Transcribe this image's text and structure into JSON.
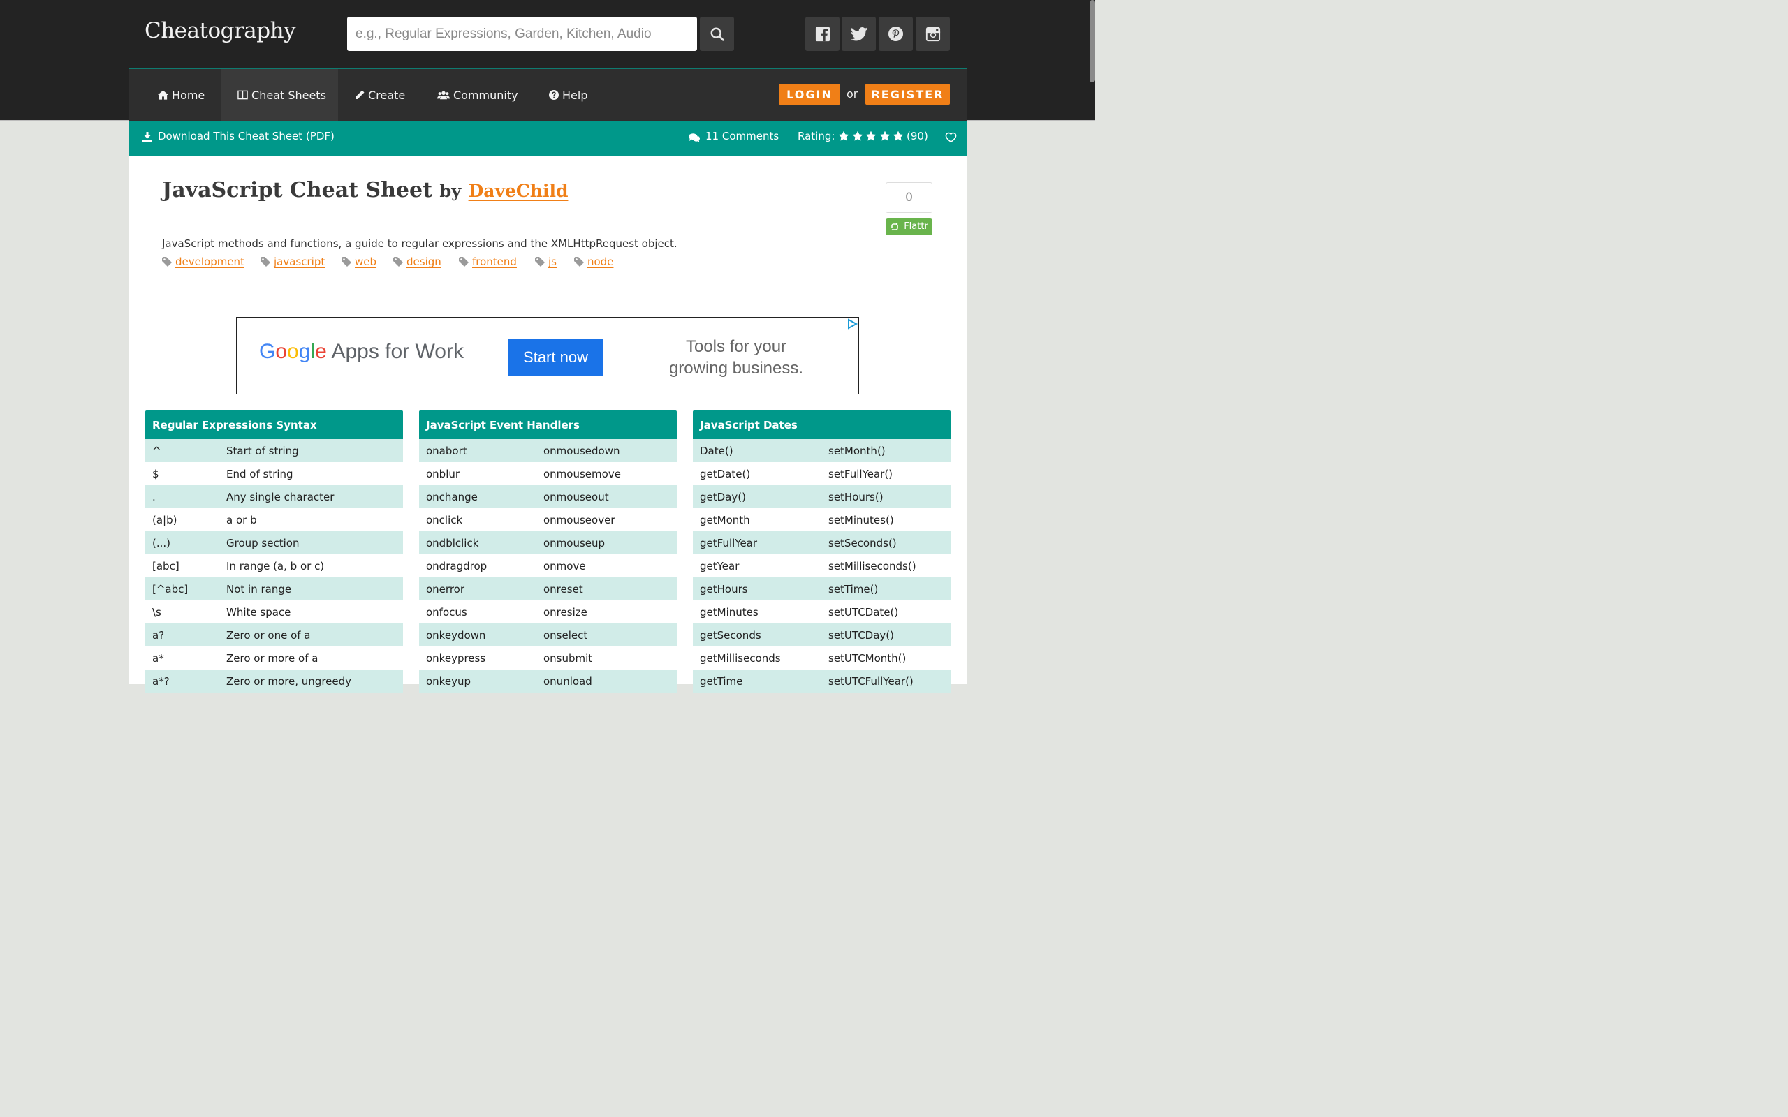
{
  "header": {
    "logo": "Cheatography",
    "search_placeholder": "e.g., Regular Expressions, Garden, Kitchen, Audio"
  },
  "nav": {
    "items": [
      {
        "label": "Home",
        "icon": "home-icon"
      },
      {
        "label": "Cheat Sheets",
        "icon": "book-icon"
      },
      {
        "label": "Create",
        "icon": "pencil-icon"
      },
      {
        "label": "Community",
        "icon": "users-icon"
      },
      {
        "label": "Help",
        "icon": "question-circle-icon"
      }
    ],
    "login": "LOGIN",
    "or": "or",
    "register": "REGISTER"
  },
  "toolbar": {
    "download": "Download This Cheat Sheet (PDF)",
    "comments": "11 Comments",
    "rating_label": "Rating:",
    "stars": 5,
    "rating_count": "(90)"
  },
  "sheet": {
    "title": "JavaScript Cheat Sheet",
    "by": "by",
    "author": "DaveChild",
    "description": "JavaScript methods and functions, a guide to regular expressions and the XMLHttpRequest object.",
    "tags": [
      "development",
      "javascript",
      "web",
      "design",
      "frontend",
      "js",
      "node"
    ],
    "flattr_count": "0",
    "flattr_label": "Flattr"
  },
  "ad": {
    "brand_rest": "Apps for Work",
    "cta": "Start now",
    "tagline": "Tools for your growing business."
  },
  "boxes": [
    {
      "title": "Regular Expressions Syntax",
      "rows": [
        [
          "^",
          "Start of string"
        ],
        [
          "$",
          "End of string"
        ],
        [
          ".",
          "Any single character"
        ],
        [
          "(a|b)",
          "a or b"
        ],
        [
          "(...)",
          "Group section"
        ],
        [
          "[abc]",
          "In range (a, b or c)"
        ],
        [
          "[^abc]",
          "Not in range"
        ],
        [
          "\\s",
          "White space"
        ],
        [
          "a?",
          "Zero or one of a"
        ],
        [
          "a*",
          "Zero or more of a"
        ],
        [
          "a*?",
          "Zero or more, ungreedy"
        ]
      ]
    },
    {
      "title": "JavaScript Event Handlers",
      "rows": [
        [
          "onabort",
          "onmousedown"
        ],
        [
          "onblur",
          "onmousemove"
        ],
        [
          "onchange",
          "onmouseout"
        ],
        [
          "onclick",
          "onmouseover"
        ],
        [
          "ondblclick",
          "onmouseup"
        ],
        [
          "ondragdrop",
          "onmove"
        ],
        [
          "onerror",
          "onreset"
        ],
        [
          "onfocus",
          "onresize"
        ],
        [
          "onkeydown",
          "onselect"
        ],
        [
          "onkeypress",
          "onsubmit"
        ],
        [
          "onkeyup",
          "onunload"
        ]
      ]
    },
    {
      "title": "JavaScript Dates",
      "rows": [
        [
          "Date()",
          "setMonth()"
        ],
        [
          "getDate()",
          "setFullYear()"
        ],
        [
          "getDay()",
          "setHours()"
        ],
        [
          "getMonth",
          "setMinutes()"
        ],
        [
          "getFullYear",
          "setSeconds()"
        ],
        [
          "getYear",
          "setMilliseconds()"
        ],
        [
          "getHours",
          "setTime()"
        ],
        [
          "getMinutes",
          "setUTCDate()"
        ],
        [
          "getSeconds",
          "setUTCDay()"
        ],
        [
          "getMilliseconds",
          "setUTCMonth()"
        ],
        [
          "getTime",
          "setUTCFullYear()"
        ]
      ]
    }
  ],
  "colors": {
    "accent_orange": "#f07f17",
    "teal": "#00988a",
    "row_tint": "#d1ece8",
    "dark_header": "#232323"
  }
}
